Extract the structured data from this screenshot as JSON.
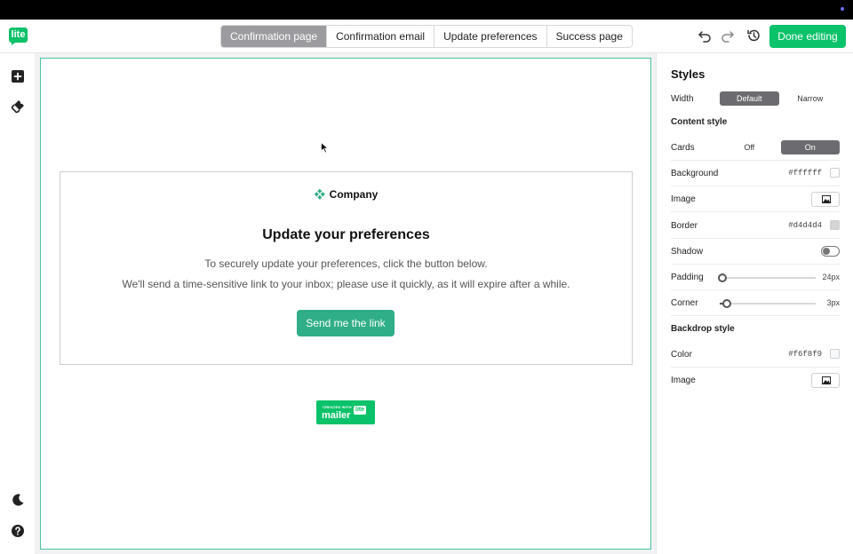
{
  "header": {
    "logo_text": "lite",
    "tabs": [
      {
        "label": "Confirmation page",
        "active": true
      },
      {
        "label": "Confirmation email",
        "active": false
      },
      {
        "label": "Update preferences",
        "active": false
      },
      {
        "label": "Success page",
        "active": false
      }
    ],
    "done_label": "Done editing",
    "accent_color": "#09c269"
  },
  "card": {
    "company": "Company",
    "title": "Update your preferences",
    "text1": "To securely update your preferences, click the button below.",
    "text2": "We'll send a time-sensitive link to your inbox; please use it quickly, as it will expire after a while.",
    "button_label": "Send me the link",
    "button_color": "#2fae87"
  },
  "badge": {
    "small": "CREATED WITH",
    "main": "mailer",
    "lite": "lite"
  },
  "styles_panel": {
    "title": "Styles",
    "width": {
      "label": "Width",
      "options": [
        "Default",
        "Narrow"
      ],
      "selected": "Default"
    },
    "content_style_heading": "Content style",
    "cards": {
      "label": "Cards",
      "options": [
        "Off",
        "On"
      ],
      "selected": "On"
    },
    "background": {
      "label": "Background",
      "value": "#ffffff"
    },
    "image": {
      "label": "Image"
    },
    "border": {
      "label": "Border",
      "value": "#d4d4d4"
    },
    "shadow": {
      "label": "Shadow",
      "enabled": false
    },
    "padding": {
      "label": "Padding",
      "value": "24px",
      "level": 0.0
    },
    "corner": {
      "label": "Corner",
      "value": "3px",
      "level": 0.05
    },
    "backdrop_heading": "Backdrop style",
    "color": {
      "label": "Color",
      "value": "#f6f8f9"
    },
    "backdrop_image": {
      "label": "Image"
    }
  }
}
